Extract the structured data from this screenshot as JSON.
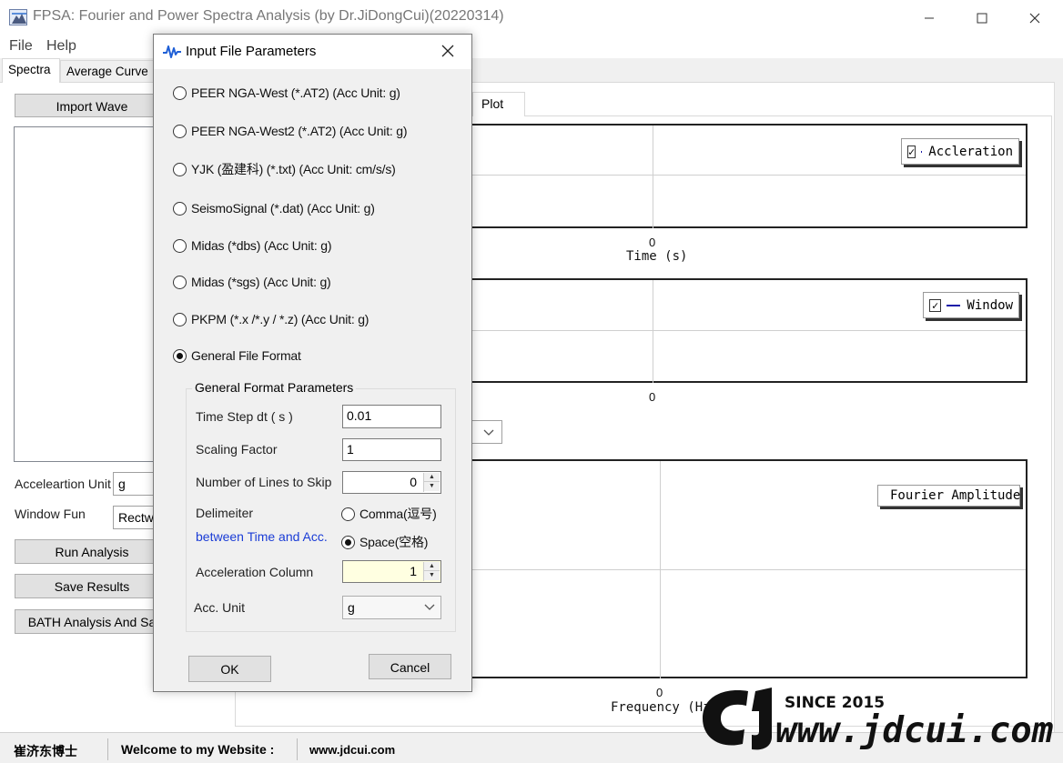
{
  "window": {
    "title": "FPSA: Fourier and Power Spectra Analysis (by Dr.JiDongCui)(20220314)",
    "min_glyph": "—",
    "max_glyph": "☐",
    "close_glyph": "✕"
  },
  "menu": {
    "file": "File",
    "help": "Help"
  },
  "tabs": {
    "spectra": "Spectra",
    "average": "Average Curve"
  },
  "left": {
    "import_label": "Import Wave",
    "accel_unit_label": "Acceleartion Unit",
    "accel_unit_value": "g",
    "window_fun_label": "Window Fun",
    "window_fun_value": "Rectwi",
    "run_label": "Run Analysis",
    "save_label": "Save Results",
    "bath_label": "BATH Analysis And Sa"
  },
  "plot": {
    "tab_label": "Plot",
    "accel_chart": {
      "tick_zero": "0",
      "x_title": "Time (s)",
      "legend": "Accleration",
      "legend_color": "#1a1aa8"
    },
    "window_chart": {
      "tick_zero": "0",
      "legend": "Window",
      "legend_color": "#1a1aa8"
    },
    "fourier_chart": {
      "tick_zero": "0",
      "x_title": "Frequency (Hz",
      "legend": "Fourier Amplitude",
      "legend_color": "#b01010"
    }
  },
  "statusbar": {
    "author": "崔济东博士",
    "welcome": "Welcome to my Website :",
    "url": "www.jdcui.com"
  },
  "watermark": {
    "since": "SINCE 2015",
    "site": "www.jdcui.com"
  },
  "dialog": {
    "title": "Input File Parameters",
    "close_glyph": "✕",
    "formats": [
      {
        "label": "PEER NGA-West (*.AT2) (Acc Unit: g)",
        "selected": false
      },
      {
        "label": "PEER NGA-West2 (*.AT2) (Acc Unit: g)",
        "selected": false
      },
      {
        "label": "YJK (盈建科) (*.txt) (Acc Unit: cm/s/s)",
        "selected": false
      },
      {
        "label": "SeismoSignal (*.dat) (Acc Unit: g)",
        "selected": false
      },
      {
        "label": "Midas (*dbs) (Acc Unit: g)",
        "selected": false
      },
      {
        "label": "Midas (*sgs) (Acc Unit: g)",
        "selected": false
      },
      {
        "label": "PKPM (*.x /*.y / *.z) (Acc Unit: g)",
        "selected": false
      },
      {
        "label": "General File Format",
        "selected": true
      }
    ],
    "group": {
      "title": "General Format Parameters",
      "time_step_label": "Time Step dt ( s )",
      "time_step_value": "0.01",
      "scaling_label": "Scaling Factor",
      "scaling_value": "1",
      "skip_label": "Number of Lines to Skip",
      "skip_value": "0",
      "delimiter_label": "Delimeiter",
      "delimiter_sub": "between Time and Acc.",
      "delimiter_sub_color": "#1a3cd6",
      "comma_label": "Comma(逗号)",
      "space_label": "Space(空格)",
      "delimiter_selected": "space",
      "acc_col_label": "Acceleration Column",
      "acc_col_value": "1",
      "acc_unit_label": "Acc. Unit",
      "acc_unit_value": "g"
    },
    "ok_label": "OK",
    "cancel_label": "Cancel"
  }
}
